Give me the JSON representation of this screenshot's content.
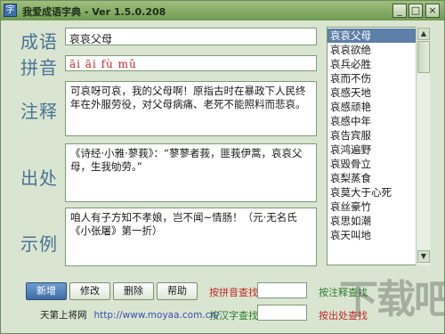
{
  "window": {
    "title": "我爱成语字典 - Ver 1.5.0.208",
    "icon_text": "字",
    "minimize": "_",
    "maximize": "□",
    "close": "×"
  },
  "labels": {
    "idiom": "成语",
    "pinyin": "拼音",
    "annotation": "注释",
    "source": "出处",
    "example": "示例"
  },
  "fields": {
    "idiom": "哀哀父母",
    "pinyin": "āi  āi  fù  mǔ",
    "annotation": "可哀呀可哀，我的父母啊！原指古时在暴政下人民终年在外服劳役，对父母病痛、老死不能照料而悲哀。",
    "source": "《诗经·小雅·蓼莪》：“蓼蓼者莪，匪莪伊蒿，哀哀父母，生我劬劳。”",
    "example": "咱人有子方知不孝娘，岂不闻~情肠！（元·无名氏《小张屠》第一折）"
  },
  "list": {
    "items": [
      "哀哀父母",
      "哀哀欲绝",
      "哀兵必胜",
      "哀而不伤",
      "哀感天地",
      "哀感顽艳",
      "哀感中年",
      "哀告宾服",
      "哀鸿遍野",
      "哀毁骨立",
      "哀梨蒸食",
      "哀莫大于心死",
      "哀丝豪竹",
      "哀思如潮",
      "哀天叫地"
    ],
    "selected_index": 0,
    "scroll_up": "▲",
    "scroll_down": "▼"
  },
  "buttons": {
    "add": "新增",
    "edit": "修改",
    "delete": "删除",
    "help": "帮助"
  },
  "search": {
    "pinyin_label": "按拼音查找",
    "hanzi_label": "按汉字查找",
    "annotation_label": "按注释查找",
    "source_label": "按出处查找"
  },
  "footer": {
    "site_name": "天第上将网",
    "url": "http://www.moyaa.com.cn/"
  },
  "watermark": "下载吧",
  "colors": {
    "label": "#4b7396",
    "pinyin": "#c0282a",
    "search_red": "#c0282a",
    "search_green": "#2f7a2f",
    "selected_row": "#5e7fa8"
  }
}
